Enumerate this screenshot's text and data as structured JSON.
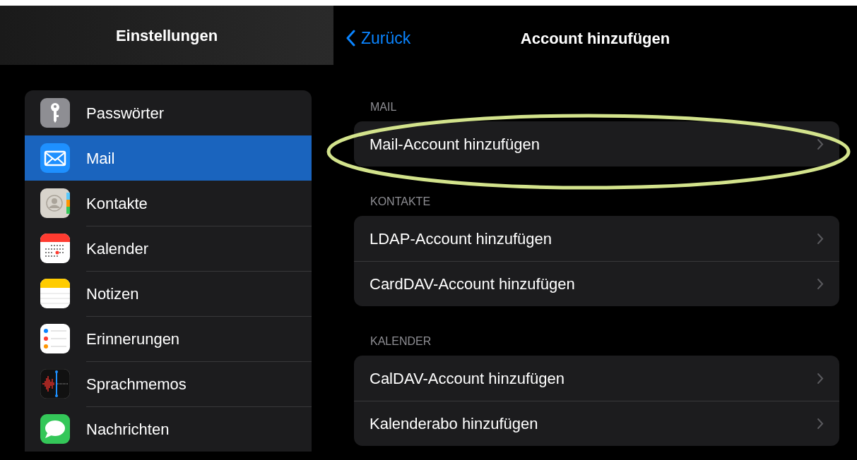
{
  "sidebar": {
    "title": "Einstellungen",
    "items": [
      {
        "label": "Passwörter",
        "kind": "key",
        "selected": false
      },
      {
        "label": "Mail",
        "kind": "mail",
        "selected": true
      },
      {
        "label": "Kontakte",
        "kind": "contacts",
        "selected": false
      },
      {
        "label": "Kalender",
        "kind": "calendar",
        "selected": false
      },
      {
        "label": "Notizen",
        "kind": "notes",
        "selected": false
      },
      {
        "label": "Erinnerungen",
        "kind": "reminders",
        "selected": false
      },
      {
        "label": "Sprachmemos",
        "kind": "voicememos",
        "selected": false
      },
      {
        "label": "Nachrichten",
        "kind": "messages",
        "selected": false
      }
    ]
  },
  "detail": {
    "back_label": "Zurück",
    "title": "Account hinzufügen",
    "sections": [
      {
        "header": "MAIL",
        "highlighted": true,
        "rows": [
          "Mail-Account hinzufügen"
        ]
      },
      {
        "header": "KONTAKTE",
        "highlighted": false,
        "rows": [
          "LDAP-Account hinzufügen",
          "CardDAV-Account hinzufügen"
        ]
      },
      {
        "header": "KALENDER",
        "highlighted": false,
        "rows": [
          "CalDAV-Account hinzufügen",
          "Kalenderabo hinzufügen"
        ]
      }
    ]
  }
}
